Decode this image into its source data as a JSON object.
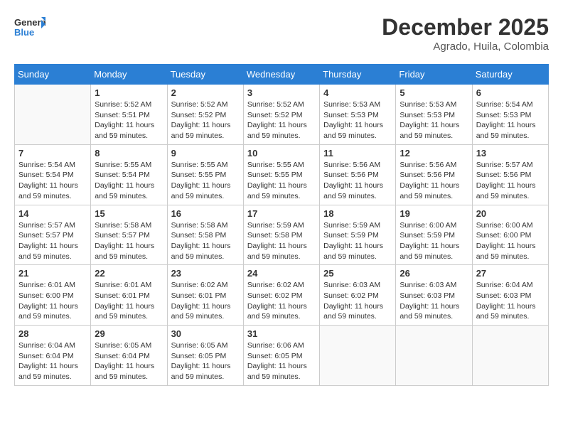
{
  "header": {
    "logo_general": "General",
    "logo_blue": "Blue",
    "month": "December 2025",
    "location": "Agrado, Huila, Colombia"
  },
  "days_of_week": [
    "Sunday",
    "Monday",
    "Tuesday",
    "Wednesday",
    "Thursday",
    "Friday",
    "Saturday"
  ],
  "weeks": [
    [
      {
        "day": "",
        "info": ""
      },
      {
        "day": "1",
        "info": "Sunrise: 5:52 AM\nSunset: 5:51 PM\nDaylight: 11 hours\nand 59 minutes."
      },
      {
        "day": "2",
        "info": "Sunrise: 5:52 AM\nSunset: 5:52 PM\nDaylight: 11 hours\nand 59 minutes."
      },
      {
        "day": "3",
        "info": "Sunrise: 5:52 AM\nSunset: 5:52 PM\nDaylight: 11 hours\nand 59 minutes."
      },
      {
        "day": "4",
        "info": "Sunrise: 5:53 AM\nSunset: 5:53 PM\nDaylight: 11 hours\nand 59 minutes."
      },
      {
        "day": "5",
        "info": "Sunrise: 5:53 AM\nSunset: 5:53 PM\nDaylight: 11 hours\nand 59 minutes."
      },
      {
        "day": "6",
        "info": "Sunrise: 5:54 AM\nSunset: 5:53 PM\nDaylight: 11 hours\nand 59 minutes."
      }
    ],
    [
      {
        "day": "7",
        "info": "Sunrise: 5:54 AM\nSunset: 5:54 PM\nDaylight: 11 hours\nand 59 minutes."
      },
      {
        "day": "8",
        "info": "Sunrise: 5:55 AM\nSunset: 5:54 PM\nDaylight: 11 hours\nand 59 minutes."
      },
      {
        "day": "9",
        "info": "Sunrise: 5:55 AM\nSunset: 5:55 PM\nDaylight: 11 hours\nand 59 minutes."
      },
      {
        "day": "10",
        "info": "Sunrise: 5:55 AM\nSunset: 5:55 PM\nDaylight: 11 hours\nand 59 minutes."
      },
      {
        "day": "11",
        "info": "Sunrise: 5:56 AM\nSunset: 5:56 PM\nDaylight: 11 hours\nand 59 minutes."
      },
      {
        "day": "12",
        "info": "Sunrise: 5:56 AM\nSunset: 5:56 PM\nDaylight: 11 hours\nand 59 minutes."
      },
      {
        "day": "13",
        "info": "Sunrise: 5:57 AM\nSunset: 5:56 PM\nDaylight: 11 hours\nand 59 minutes."
      }
    ],
    [
      {
        "day": "14",
        "info": "Sunrise: 5:57 AM\nSunset: 5:57 PM\nDaylight: 11 hours\nand 59 minutes."
      },
      {
        "day": "15",
        "info": "Sunrise: 5:58 AM\nSunset: 5:57 PM\nDaylight: 11 hours\nand 59 minutes."
      },
      {
        "day": "16",
        "info": "Sunrise: 5:58 AM\nSunset: 5:58 PM\nDaylight: 11 hours\nand 59 minutes."
      },
      {
        "day": "17",
        "info": "Sunrise: 5:59 AM\nSunset: 5:58 PM\nDaylight: 11 hours\nand 59 minutes."
      },
      {
        "day": "18",
        "info": "Sunrise: 5:59 AM\nSunset: 5:59 PM\nDaylight: 11 hours\nand 59 minutes."
      },
      {
        "day": "19",
        "info": "Sunrise: 6:00 AM\nSunset: 5:59 PM\nDaylight: 11 hours\nand 59 minutes."
      },
      {
        "day": "20",
        "info": "Sunrise: 6:00 AM\nSunset: 6:00 PM\nDaylight: 11 hours\nand 59 minutes."
      }
    ],
    [
      {
        "day": "21",
        "info": "Sunrise: 6:01 AM\nSunset: 6:00 PM\nDaylight: 11 hours\nand 59 minutes."
      },
      {
        "day": "22",
        "info": "Sunrise: 6:01 AM\nSunset: 6:01 PM\nDaylight: 11 hours\nand 59 minutes."
      },
      {
        "day": "23",
        "info": "Sunrise: 6:02 AM\nSunset: 6:01 PM\nDaylight: 11 hours\nand 59 minutes."
      },
      {
        "day": "24",
        "info": "Sunrise: 6:02 AM\nSunset: 6:02 PM\nDaylight: 11 hours\nand 59 minutes."
      },
      {
        "day": "25",
        "info": "Sunrise: 6:03 AM\nSunset: 6:02 PM\nDaylight: 11 hours\nand 59 minutes."
      },
      {
        "day": "26",
        "info": "Sunrise: 6:03 AM\nSunset: 6:03 PM\nDaylight: 11 hours\nand 59 minutes."
      },
      {
        "day": "27",
        "info": "Sunrise: 6:04 AM\nSunset: 6:03 PM\nDaylight: 11 hours\nand 59 minutes."
      }
    ],
    [
      {
        "day": "28",
        "info": "Sunrise: 6:04 AM\nSunset: 6:04 PM\nDaylight: 11 hours\nand 59 minutes."
      },
      {
        "day": "29",
        "info": "Sunrise: 6:05 AM\nSunset: 6:04 PM\nDaylight: 11 hours\nand 59 minutes."
      },
      {
        "day": "30",
        "info": "Sunrise: 6:05 AM\nSunset: 6:05 PM\nDaylight: 11 hours\nand 59 minutes."
      },
      {
        "day": "31",
        "info": "Sunrise: 6:06 AM\nSunset: 6:05 PM\nDaylight: 11 hours\nand 59 minutes."
      },
      {
        "day": "",
        "info": ""
      },
      {
        "day": "",
        "info": ""
      },
      {
        "day": "",
        "info": ""
      }
    ]
  ]
}
